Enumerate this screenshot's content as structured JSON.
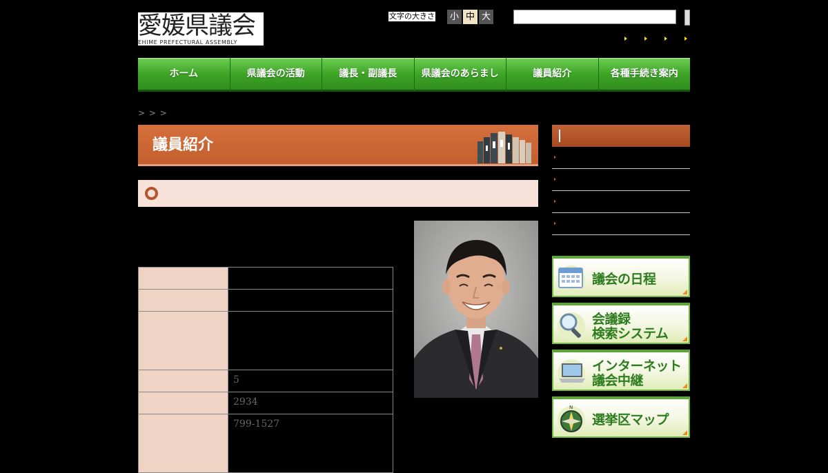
{
  "header": {
    "logo_jp": "愛媛県議会",
    "logo_en": "EHIME PREFECTURAL ASSEMBLY",
    "font_size_label": "文字の大きさ",
    "font_sizes": [
      "小",
      "中",
      "大"
    ],
    "search": {
      "value": "",
      "placeholder": ""
    }
  },
  "nav": {
    "items": [
      {
        "label": "ホーム"
      },
      {
        "label": "県議会の活動"
      },
      {
        "label": "議長・副議長"
      },
      {
        "label": "県議会のあらまし"
      },
      {
        "label": "議員紹介"
      },
      {
        "label": "各種手続き案内"
      }
    ]
  },
  "breadcrumb": ">  >  >",
  "main": {
    "page_title": "議員紹介",
    "subheading": "",
    "profile_rows": [
      {
        "value": ""
      },
      {
        "value": ""
      },
      {
        "value": ""
      },
      {
        "value": "5"
      },
      {
        "value": "2934"
      },
      {
        "value": "799-1527"
      }
    ]
  },
  "sidebar": {
    "heading": "",
    "items": [
      "",
      "",
      "",
      ""
    ],
    "banners": [
      {
        "line1": "議会の日程",
        "line2": "",
        "icon": "calendar-icon"
      },
      {
        "line1": "会議録",
        "line2": "検索システム",
        "icon": "magnifier-icon"
      },
      {
        "line1": "インターネット",
        "line2": "議会中継",
        "icon": "laptop-icon"
      },
      {
        "line1": "選挙区マップ",
        "line2": "",
        "icon": "compass-icon"
      }
    ]
  },
  "colors": {
    "nav_green": "#3da426",
    "banner_orange": "#c35e2e",
    "subhead_bg": "#f6e2d8",
    "table_key_bg": "#efd4c6",
    "sidebar_heading": "#a84a1f",
    "banner_text_green": "#2d7d1e"
  }
}
